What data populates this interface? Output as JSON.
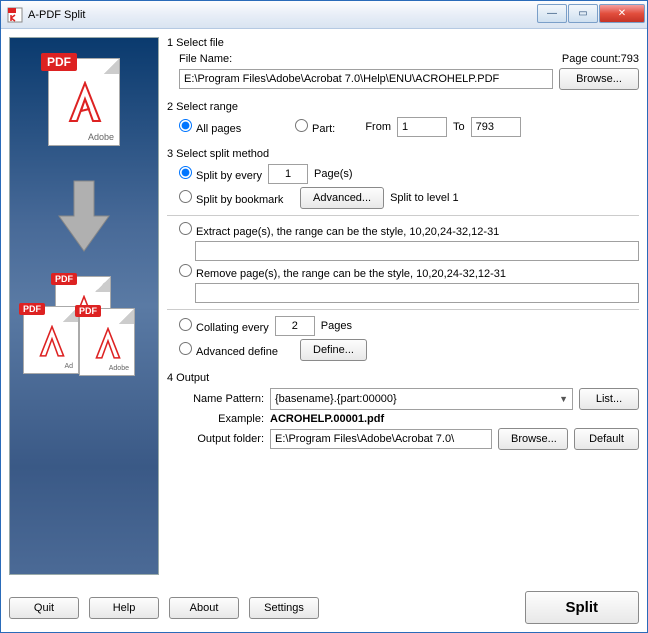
{
  "window": {
    "title": "A-PDF Split"
  },
  "section1": {
    "title": "1 Select file",
    "fileNameLabel": "File Name:",
    "fileName": "E:\\Program Files\\Adobe\\Acrobat 7.0\\Help\\ENU\\ACROHELP.PDF",
    "pageCountLabel": "Page count:",
    "pageCount": "793",
    "browse": "Browse..."
  },
  "section2": {
    "title": "2 Select range",
    "allPages": "All pages",
    "part": "Part:",
    "fromLabel": "From",
    "from": "1",
    "toLabel": "To",
    "to": "793"
  },
  "section3": {
    "title": "3 Select split method",
    "splitEvery": "Split by every",
    "splitEveryVal": "1",
    "pages": "Page(s)",
    "splitBookmark": "Split by bookmark",
    "advanced": "Advanced...",
    "splitLevel": "Split to level 1",
    "extract": "Extract page(s), the range can be the style, 10,20,24-32,12-31",
    "remove": "Remove page(s), the range can be the style, 10,20,24-32,12-31",
    "collating": "Collating every",
    "collatingVal": "2",
    "collatingPages": "Pages",
    "advDefine": "Advanced define",
    "define": "Define..."
  },
  "section4": {
    "title": "4 Output",
    "namePatternLabel": "Name Pattern:",
    "namePattern": "{basename}.{part:00000}",
    "list": "List...",
    "exampleLabel": "Example:",
    "example": "ACROHELP.00001.pdf",
    "outputFolderLabel": "Output folder:",
    "outputFolder": "E:\\Program Files\\Adobe\\Acrobat 7.0\\",
    "browse": "Browse...",
    "default": "Default"
  },
  "footer": {
    "quit": "Quit",
    "help": "Help",
    "about": "About",
    "settings": "Settings",
    "split": "Split"
  }
}
